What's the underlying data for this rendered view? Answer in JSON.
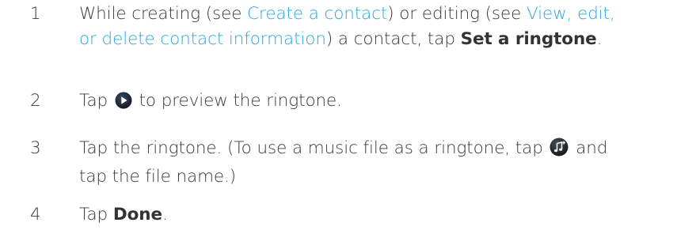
{
  "steps": [
    {
      "number": "1",
      "seg1": "While creating (see ",
      "link1": "Create a contact",
      "seg2": ") or editing (see ",
      "link2": "View, edit, or delete contact information",
      "seg3": ") a contact, tap ",
      "bold": "Set a ringtone",
      "seg4": "."
    },
    {
      "number": "2",
      "seg1": "Tap ",
      "icon": "play-icon",
      "seg2": " to preview the ringtone."
    },
    {
      "number": "3",
      "seg1": "Tap the ringtone. (To use a music file as a ringtone, tap ",
      "icon": "music-note-icon",
      "seg2": " and tap the file name.)"
    },
    {
      "number": "4",
      "seg1": "Tap ",
      "bold": "Done",
      "seg2": "."
    }
  ],
  "colors": {
    "text": "#3a3a3a",
    "link": "#2aa8df",
    "icon_dark": "#1b2330"
  }
}
